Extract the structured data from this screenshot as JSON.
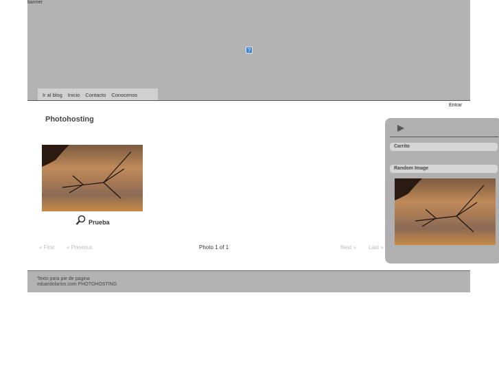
{
  "banner": {
    "label": "banner",
    "icon": "broken-image-icon",
    "icon_glyph": "?"
  },
  "nav": {
    "items": [
      {
        "label": "Ir al blog"
      },
      {
        "label": "Inicio"
      },
      {
        "label": "Contacto"
      },
      {
        "label": "Conocenos"
      }
    ]
  },
  "login": {
    "label": "Entrar"
  },
  "page": {
    "title": "Photohosting"
  },
  "photo": {
    "caption": "Prueba",
    "zoom_icon": "magnifier-icon"
  },
  "pager": {
    "first": "« First",
    "previous": "« Previous",
    "count": "Photo 1 of 1",
    "next": "Next »",
    "last": "Last »"
  },
  "sidebar": {
    "play_icon": "play-icon",
    "cart_title": "Carrito",
    "random_title": "Random Image"
  },
  "footer": {
    "line1": "Texto para pie de pagina",
    "line2": "eduardolarios.com PHOTOHOSTING"
  },
  "colors": {
    "banner_bg": "#b3b3b3",
    "nav_bg": "#d0d0d0",
    "sidebar_bg": "#b0b0b0",
    "footer_bg": "#b3b3b3"
  }
}
